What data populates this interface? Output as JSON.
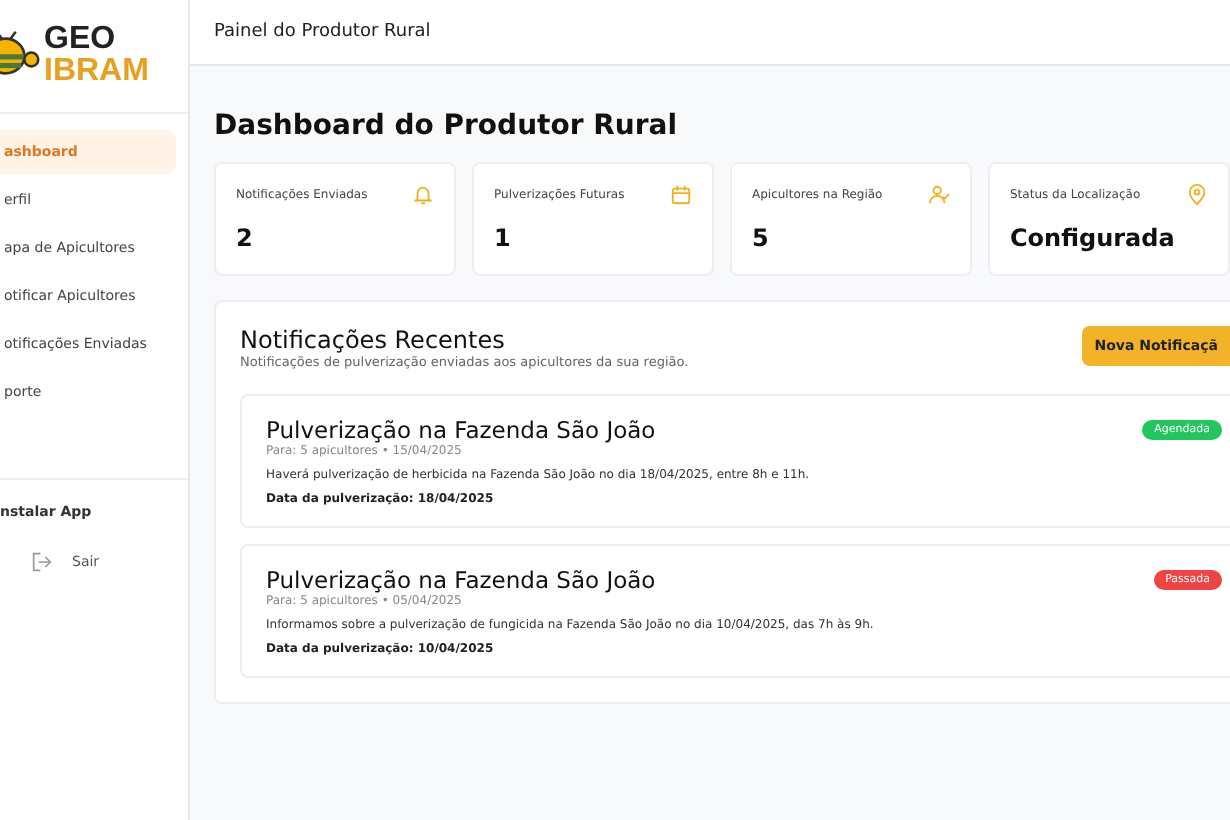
{
  "logo": {
    "line_1": "GEO",
    "line_2": "IBRAM"
  },
  "sidebar": {
    "items": [
      {
        "label": "ashboard",
        "selected": true
      },
      {
        "label": "erfil",
        "selected": false
      },
      {
        "label": "apa de Apicultores",
        "selected": false
      },
      {
        "label": "otificar Apicultores",
        "selected": false
      },
      {
        "label": "otificações Enviadas",
        "selected": false
      },
      {
        "label": "porte",
        "selected": false
      }
    ],
    "install": "nstalar App",
    "logout": "Sair"
  },
  "header": {
    "title": "Painel do Produtor Rural"
  },
  "page_title": "Dashboard do Produtor Rural",
  "stats": [
    {
      "label": "Notificações Enviadas",
      "value": "2",
      "kind": "bell"
    },
    {
      "label": "Pulverizações Futuras",
      "value": "1",
      "kind": "calendar"
    },
    {
      "label": "Apicultores na Região",
      "value": "5",
      "kind": "people"
    },
    {
      "label": "Status da Localização",
      "value": "Configurada",
      "kind": "location"
    }
  ],
  "recent": {
    "title": "Notificações Recentes",
    "subtitle": "Notificações de pulverização enviadas aos apicultores da sua região.",
    "button": "Nova Notificaçã",
    "items": [
      {
        "title": "Pulverização na Fazenda São João",
        "meta": "Para: 5 apicultores • 15/04/2025",
        "body": "Haverá pulverização de herbicida na Fazenda São João no dia 18/04/2025, entre 8h e 11h.",
        "date": "Data da pulverização: 18/04/2025",
        "status": {
          "label": "Agendada",
          "color": "#22c55e"
        }
      },
      {
        "title": "Pulverização na Fazenda São João",
        "meta": "Para: 5 apicultores • 05/04/2025",
        "body": "Informamos sobre a pulverização de fungicida na Fazenda São João no dia 10/04/2025, das 7h às 9h.",
        "date": "Data da pulverização: 10/04/2025",
        "status": {
          "label": "Passada",
          "color": "#ef4444"
        }
      }
    ]
  }
}
